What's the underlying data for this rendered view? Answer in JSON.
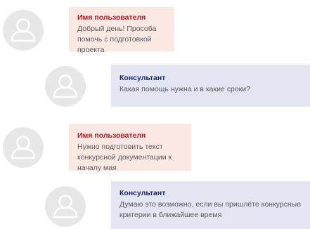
{
  "messages": [
    {
      "role": "user",
      "author": "Имя пользователя",
      "text": "Добрый день! Прособа помочь с подготовкой проекта"
    },
    {
      "role": "consultant",
      "author": "Консультант",
      "text": "Какая помощь нужна и в какие сроки?"
    },
    {
      "role": "user",
      "author": "Имя пользователя",
      "text": "Нужно подготовить текст конкурсной документации к началу мая"
    },
    {
      "role": "consultant",
      "author": "Консультант",
      "text": "Думаю это возможно, если вы пришлёте конкурсные критерии в ближайшее время"
    }
  ],
  "colors": {
    "user_bubble": "#fbe8e2",
    "consultant_bubble": "#e3e6f2",
    "user_name": "#d0131a",
    "consultant_name": "#1b2a6b",
    "avatar_bg": "#e7e7e7"
  },
  "icons": {
    "avatar": "user-silhouette-icon"
  }
}
